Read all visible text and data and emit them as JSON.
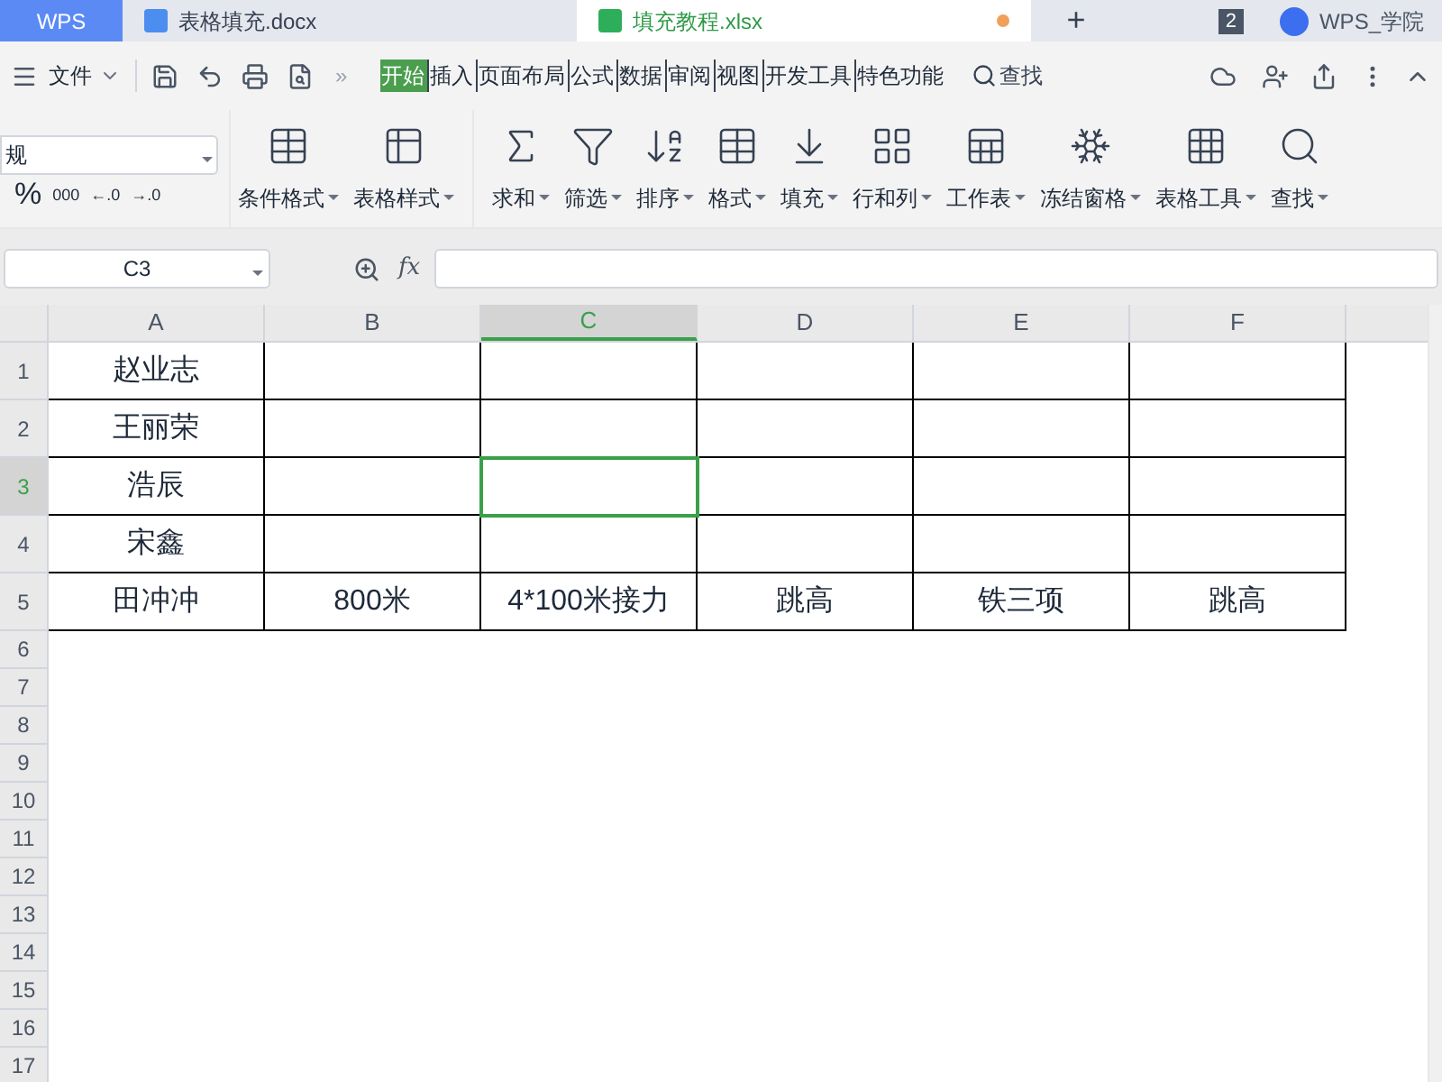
{
  "title_bar": {
    "app": "WPS",
    "tabs": [
      {
        "kind": "doc",
        "label": "表格填充.docx",
        "selected": false
      },
      {
        "kind": "sheet",
        "label": "填充教程.xlsx",
        "selected": true,
        "modified": true
      }
    ],
    "new_tab": "+",
    "window_count": "2",
    "account": "WPS_学院"
  },
  "menu": {
    "file": "文件",
    "more": "»",
    "tabs": [
      {
        "label": "开始",
        "selected": true
      },
      {
        "label": "插入",
        "selected": false
      },
      {
        "label": "页面布局",
        "selected": false
      },
      {
        "label": "公式",
        "selected": false
      },
      {
        "label": "数据",
        "selected": false
      },
      {
        "label": "审阅",
        "selected": false
      },
      {
        "label": "视图",
        "selected": false
      },
      {
        "label": "开发工具",
        "selected": false
      },
      {
        "label": "特色功能",
        "selected": false
      }
    ],
    "search": "查找"
  },
  "ribbon": {
    "format_field": "规",
    "number_buttons": [
      "%",
      "000",
      "←.0",
      "→.0"
    ],
    "tools": [
      {
        "kind": "cond",
        "label": "条件格式"
      },
      {
        "kind": "table",
        "label": "表格样式"
      },
      {
        "kind": "sum",
        "label": "求和"
      },
      {
        "kind": "filter",
        "label": "筛选"
      },
      {
        "kind": "sort",
        "label": "排序"
      },
      {
        "kind": "format",
        "label": "格式"
      },
      {
        "kind": "fill",
        "label": "填充"
      },
      {
        "kind": "rowcol",
        "label": "行和列"
      },
      {
        "kind": "sheet",
        "label": "工作表"
      },
      {
        "kind": "freeze",
        "label": "冻结窗格"
      },
      {
        "kind": "tabletool",
        "label": "表格工具"
      },
      {
        "kind": "find",
        "label": "查找"
      }
    ]
  },
  "formula_bar": {
    "name_box": "C3",
    "fx": "fx"
  },
  "columns": [
    {
      "label": "A",
      "selected": false
    },
    {
      "label": "B",
      "selected": false
    },
    {
      "label": "C",
      "selected": true
    },
    {
      "label": "D",
      "selected": false
    },
    {
      "label": "E",
      "selected": false
    },
    {
      "label": "F",
      "selected": false
    }
  ],
  "rows": [
    {
      "number": "1",
      "selected": false,
      "cells": {
        "A": "赵业志"
      }
    },
    {
      "number": "2",
      "selected": false,
      "cells": {
        "A": "王丽荣"
      }
    },
    {
      "number": "3",
      "selected": true,
      "cells": {
        "A": "浩辰"
      }
    },
    {
      "number": "4",
      "selected": false,
      "cells": {
        "A": "宋鑫"
      }
    },
    {
      "number": "5",
      "selected": false,
      "cells": {
        "A": "田冲冲",
        "B": "800米",
        "C": "4*100米接力",
        "D": "跳高",
        "E": "铁三项",
        "F": "跳高"
      }
    },
    {
      "number": "6",
      "selected": false
    },
    {
      "number": "7",
      "selected": false
    },
    {
      "number": "8",
      "selected": false
    },
    {
      "number": "9",
      "selected": false
    },
    {
      "number": "10",
      "selected": false
    },
    {
      "number": "11",
      "selected": false
    },
    {
      "number": "12",
      "selected": false
    },
    {
      "number": "13",
      "selected": false
    },
    {
      "number": "14",
      "selected": false
    },
    {
      "number": "15",
      "selected": false
    },
    {
      "number": "16",
      "selected": false
    },
    {
      "number": "17",
      "selected": false
    }
  ]
}
